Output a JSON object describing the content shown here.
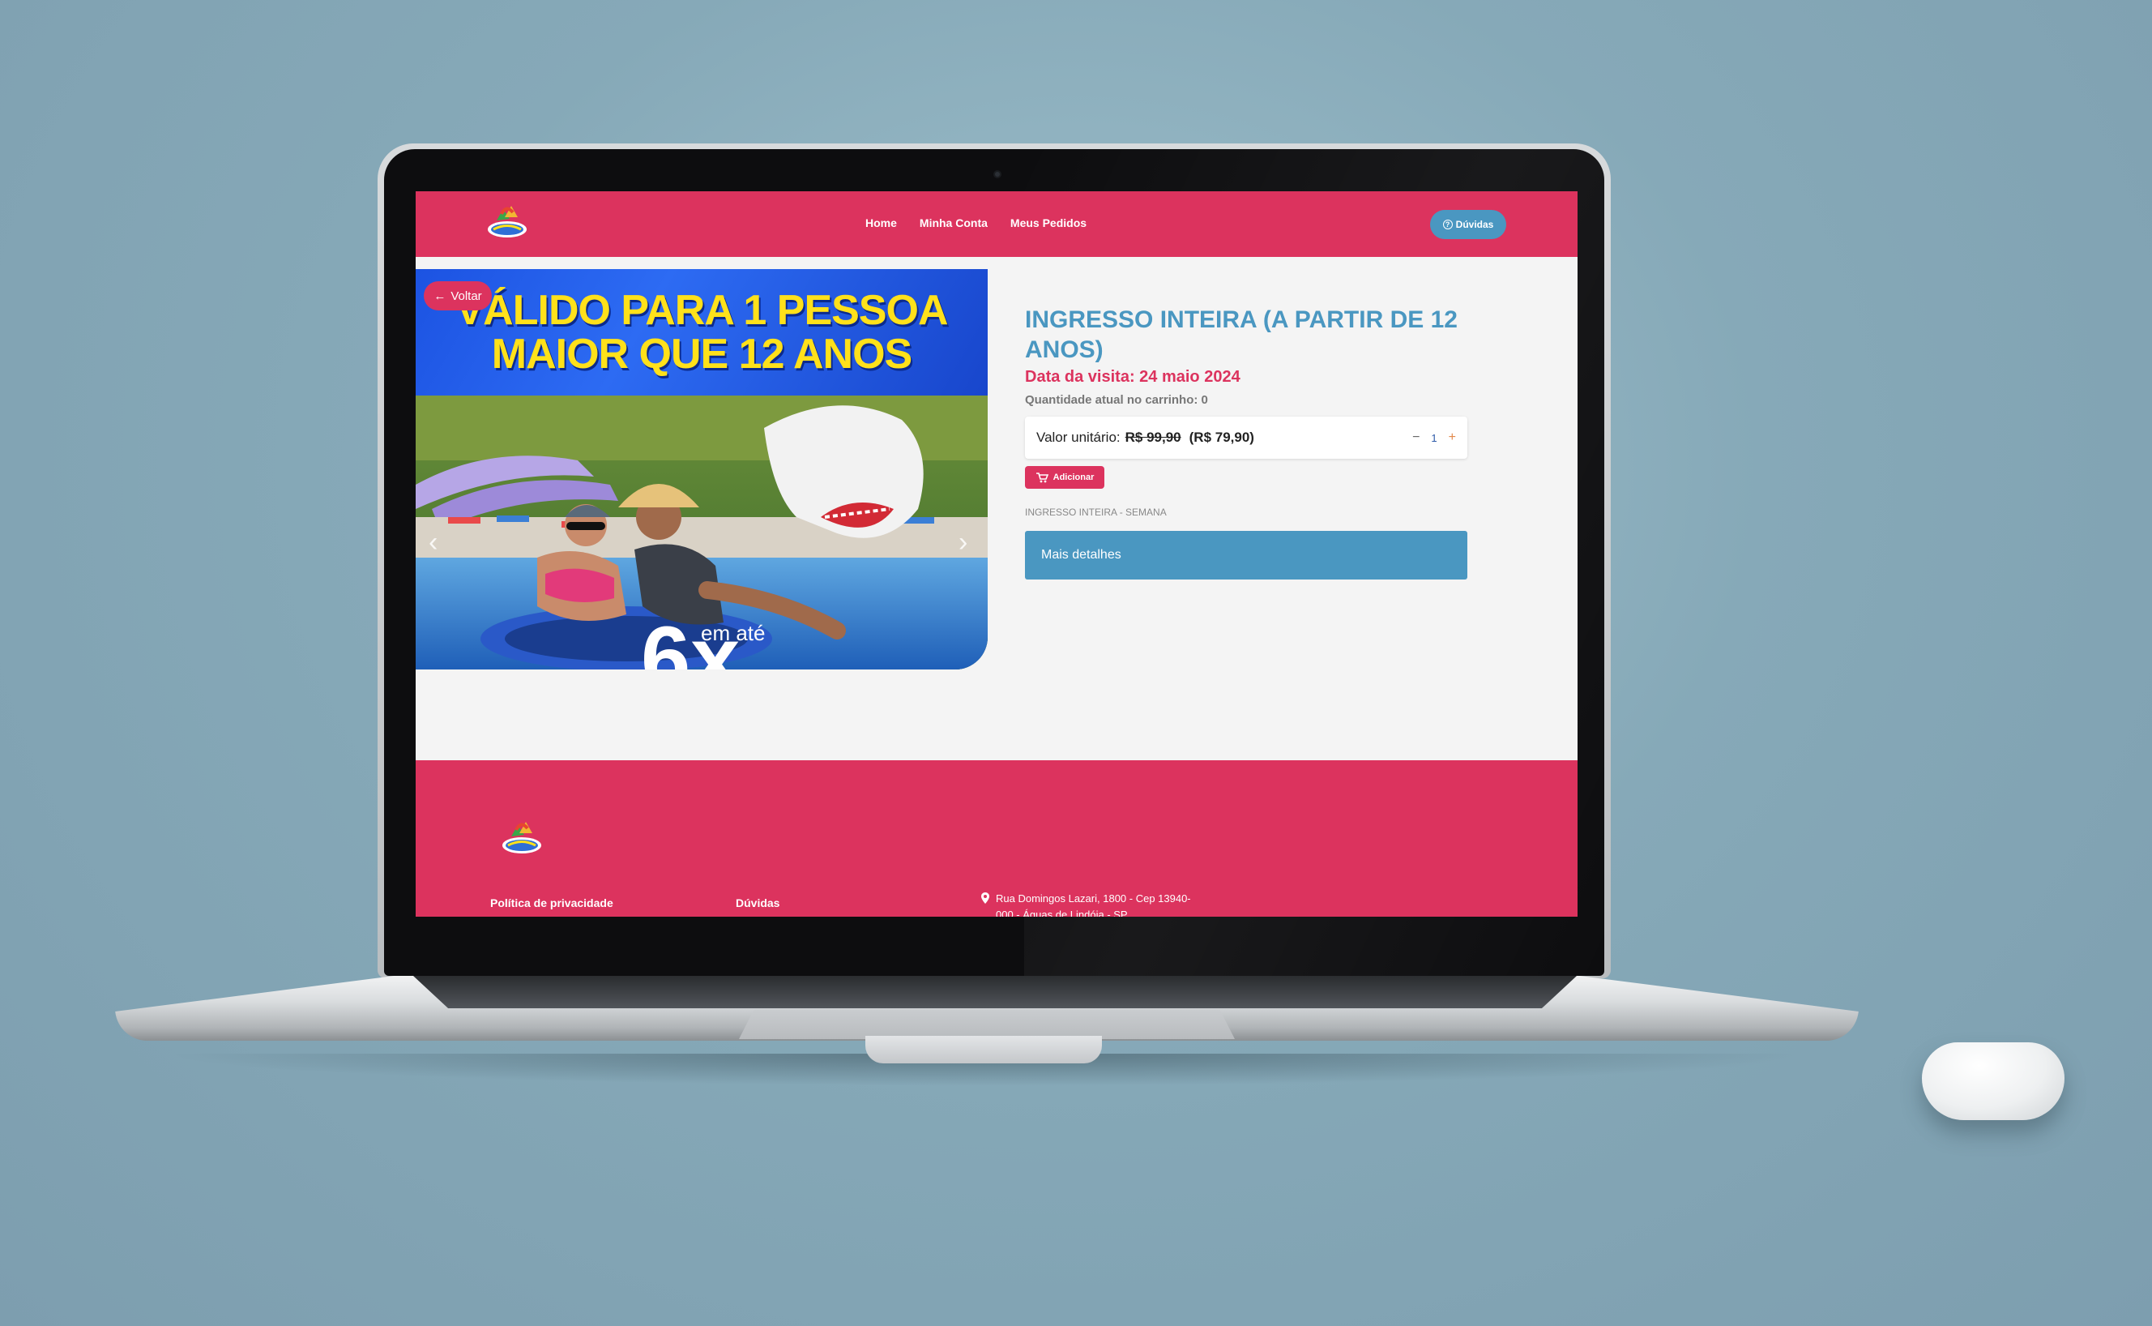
{
  "header": {
    "nav": [
      "Home",
      "Minha Conta",
      "Meus Pedidos"
    ],
    "help_label": "Dúvidas"
  },
  "banner": {
    "line1": "VÁLIDO PARA 1 PESSOA",
    "line2": "MAIOR QUE 12 ANOS",
    "cta_number": "6x",
    "cta_text": "em até"
  },
  "back_label": "Voltar",
  "product": {
    "title": "INGRESSO INTEIRA (A PARTIR DE 12 ANOS)",
    "visit_date": "Data da visita: 24 maio 2024",
    "cart_quantity": "Quantidade atual no carrinho: 0",
    "unit_label": "Valor unitário:",
    "old_price": "R$ 99,90",
    "new_price": "(R$ 79,90)",
    "stepper_minus": "−",
    "quantity": "1",
    "stepper_plus": "+",
    "add_label": "Adicionar",
    "ticket_type": "INGRESSO INTEIRA - SEMANA",
    "details_label": "Mais detalhes"
  },
  "footer": {
    "privacy_link": "Política de privacidade",
    "faq_link": "Dúvidas",
    "address": "Rua Domingos Lazari, 1800 - Cep 13940-000 - Águas de Lindóia - SP"
  },
  "colors": {
    "brand_pink": "#dc335e",
    "brand_blue": "#4a97c1",
    "banner_yellow": "#ffe11a",
    "banner_blue": "#1c53e2"
  },
  "icons": [
    "logo-icon",
    "question-icon",
    "arrow-left-icon",
    "chevron-left-icon",
    "chevron-right-icon",
    "cart-icon",
    "map-pin-icon"
  ]
}
